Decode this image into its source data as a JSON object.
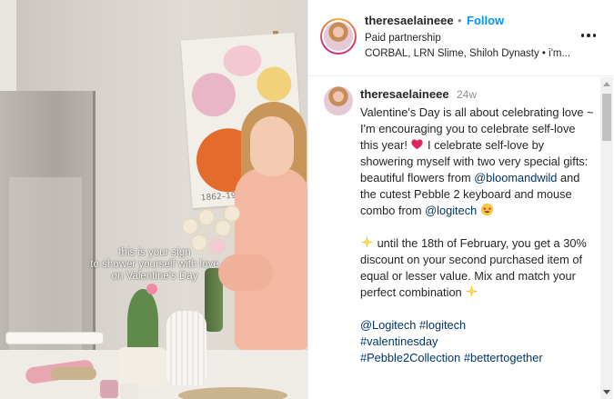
{
  "video": {
    "overlay_lines": [
      "this is your sign",
      "to shower yourself with love",
      "on Valentine's Day"
    ]
  },
  "header": {
    "username": "theresaelaineee",
    "separator": "•",
    "follow_label": "Follow",
    "subtitle": "Paid partnership",
    "collaborators": "CORBAL, LRN Slime, Shiloh Dynasty • i'm...",
    "more_icon": "more-options-icon",
    "accent": "#0095f6"
  },
  "caption": {
    "username": "theresaelaineee",
    "timestamp": "24w",
    "p1_text1": "Valentine's Day is all about celebrating love ~ I'm encouraging you to celebrate self-love this year!",
    "p1_text2": "I celebrate self-love by showering myself with two very special gifts: beautiful flowers from",
    "mention_bloom": "@bloomandwild",
    "p1_text3": "and the cutest Pebble 2 keyboard and mouse combo from",
    "mention_logitech": "@logitech",
    "p2_text": "until the 18th of February, you get a 30% discount on your second purchased item of equal or lesser value. Mix and match your perfect combination",
    "tags_line1": [
      "@Logitech",
      "#logitech"
    ],
    "tags_line2": [
      "#valentinesday"
    ],
    "tags_line3": [
      "#Pebble2Collection",
      "#bettertogether"
    ],
    "emoji_heart": "heart-emoji",
    "emoji_starstruck": "star-struck-emoji",
    "emoji_sparkle": "sparkle-emoji",
    "link_color": "#00376b"
  }
}
